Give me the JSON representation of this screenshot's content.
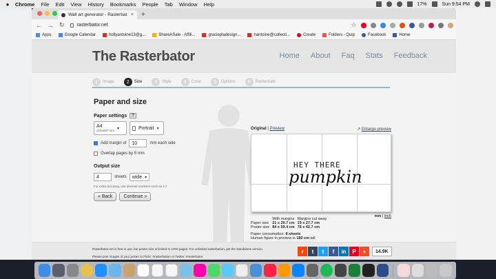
{
  "menubar": {
    "app": "Chrome",
    "items": [
      "File",
      "Edit",
      "View",
      "History",
      "Bookmarks",
      "People",
      "Tab",
      "Window",
      "Help"
    ],
    "battery": "17%",
    "clock": "Sun 9:54 PM"
  },
  "browser": {
    "tab_title": "Wall art generator - Rasterbat",
    "url": "rasterbator.net",
    "bookmarks": [
      "Apps",
      "Google Calendar",
      "hollyantoine13@g...",
      "ShareASale - Affili...",
      "graciepladesign...",
      "hantoine@collecti...",
      "Create",
      "Folders - Quip",
      "Facebook",
      "Home"
    ]
  },
  "site": {
    "logo": "The Rasterbator",
    "nav": [
      "Home",
      "About",
      "Faq",
      "Stats",
      "Feedback"
    ],
    "steps": [
      {
        "num": "1",
        "label": "Image"
      },
      {
        "num": "2",
        "label": "Size"
      },
      {
        "num": "3",
        "label": "Style"
      },
      {
        "num": "4",
        "label": "Color"
      },
      {
        "num": "5",
        "label": "Options"
      },
      {
        "num": "6",
        "label": "Rasterbate"
      }
    ]
  },
  "form": {
    "title": "Paper and size",
    "paper_settings_label": "Paper settings",
    "help": "?",
    "paper_size": "A4",
    "paper_size_sub": "210x297 mm",
    "orientation": "Portrait",
    "add_margin_label": "Add margin of",
    "margin_value": "10",
    "margin_suffix": "mm each side",
    "overlap_label": "Overlap pages by 5 mm",
    "output_size_label": "Output size",
    "sheets_value": "4",
    "sheets_label": "sheets",
    "direction": "wide",
    "accuracy_hint": "For extra accuracy, use decimal numbers such as 4.7",
    "back": "« Back",
    "continue": "Continue »"
  },
  "preview": {
    "original": "Original",
    "preview_link": "Preview",
    "enlarge": "Enlarge preview",
    "art_top": "HEY THERE",
    "art_script": "pumpkin",
    "units_mm": "mm",
    "units_inch": "inch",
    "col_with": "With margins",
    "col_cut": "Margins cut away",
    "paper_size_label": "Paper size",
    "paper_with": "21 x 29.7 cm",
    "paper_cut": "19 x 27.7 cm",
    "poster_size_label": "Poster size",
    "poster_with": "84 x 59.4 cm",
    "poster_cut": "76 x 42.7 cm",
    "consumption_label": "Paper consumption:",
    "consumption_value": "8 sheets",
    "figure_label": "Human figure in preview is",
    "figure_value": "180 cm",
    "figure_suffix": "tall"
  },
  "footer": {
    "line1": "Rasterbator.net is free to use, but poster size is limited to 1000 pages. For unlimited rasterbation, get the standalone version.",
    "line2": "Please post images of your poster to Flickr: #rasterbation or Twitter: #rasterbator",
    "share_count": "14.9K"
  }
}
